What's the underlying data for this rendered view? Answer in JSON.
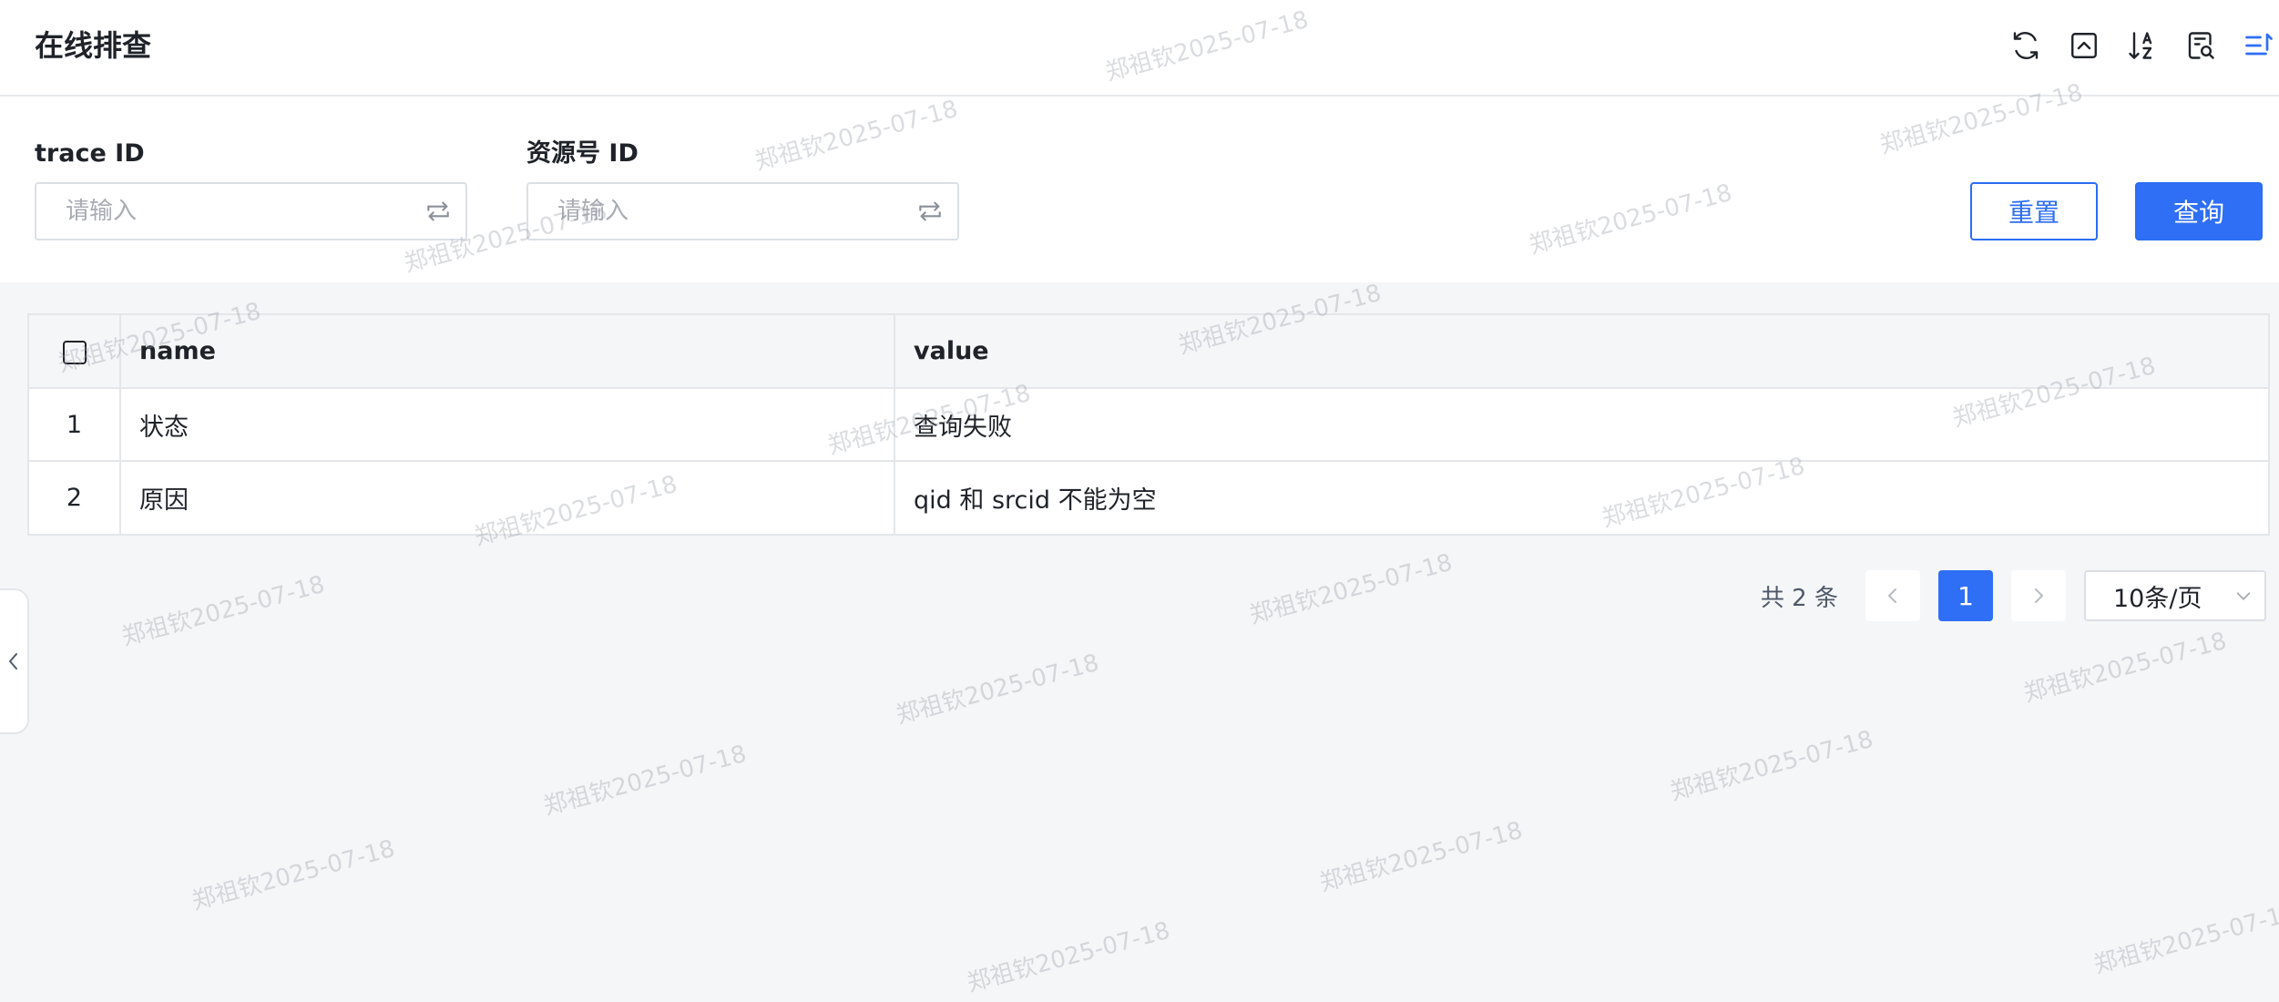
{
  "header": {
    "title": "在线排查",
    "tools": [
      "refresh-icon",
      "collapse-icon",
      "sort-az-icon",
      "search-document-icon",
      "list-settings-icon"
    ]
  },
  "filter": {
    "trace_label": "trace ID",
    "trace_placeholder": "请输入",
    "resource_label": "资源号 ID",
    "resource_placeholder": "请输入",
    "reset_label": "重置",
    "query_label": "查询"
  },
  "table": {
    "columns": {
      "name": "name",
      "value": "value"
    },
    "rows": [
      {
        "index": "1",
        "name": "状态",
        "value": "查询失败"
      },
      {
        "index": "2",
        "name": "原因",
        "value": "qid 和 srcid 不能为空"
      }
    ]
  },
  "pagination": {
    "total": "共 2 条",
    "current_page": "1",
    "page_size": "10条/页"
  },
  "watermark": "郑祖钦2025-07-18",
  "colors": {
    "primary": "#2f6ff5",
    "background": "#f5f6f7",
    "border": "#e4e6ea"
  }
}
